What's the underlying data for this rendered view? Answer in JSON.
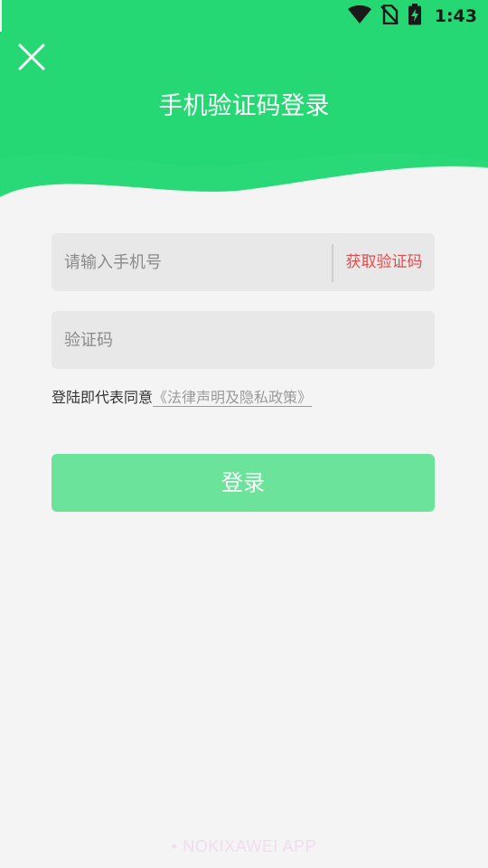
{
  "status_bar": {
    "time": "1:43",
    "icons": [
      "wifi-icon",
      "no-sim-icon",
      "battery-charging-icon"
    ]
  },
  "header": {
    "title": "手机验证码登录",
    "close_icon": "close-icon",
    "color": "#26d873"
  },
  "form": {
    "phone_placeholder": "请输入手机号",
    "get_code_label": "获取验证码",
    "code_placeholder": "验证码",
    "agreement_text": "登陆即代表同意",
    "agreement_link": "《法律声明及隐私政策》",
    "login_label": "登录"
  },
  "colors": {
    "accent_green": "#26d873",
    "button_green": "#6be39a",
    "link_red": "#e14c4c",
    "background": "#f4f4f4"
  },
  "watermark": "• NOKIXAWEI APP"
}
